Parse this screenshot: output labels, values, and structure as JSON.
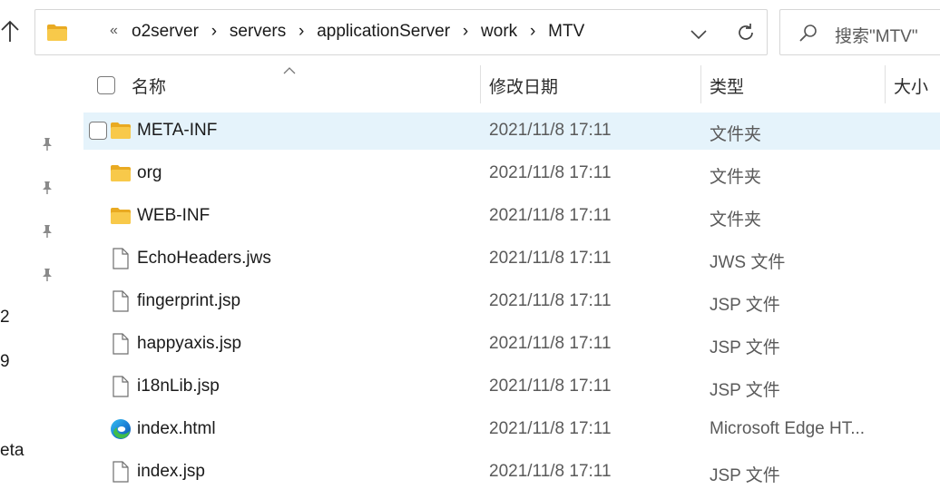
{
  "address_bar": {
    "overflow": "«",
    "crumbs": [
      "o2server",
      "servers",
      "applicationServer",
      "work",
      "MTV"
    ],
    "separator": "›"
  },
  "search": {
    "placeholder": "搜索\"MTV\""
  },
  "nav_fragments": [
    "2",
    "9",
    "eta"
  ],
  "columns": {
    "name": "名称",
    "date": "修改日期",
    "type": "类型",
    "size": "大小"
  },
  "files": [
    {
      "name": "META-INF",
      "date": "2021/11/8 17:11",
      "type": "文件夹",
      "icon": "folder-icon",
      "selected": true
    },
    {
      "name": "org",
      "date": "2021/11/8 17:11",
      "type": "文件夹",
      "icon": "folder-icon",
      "selected": false
    },
    {
      "name": "WEB-INF",
      "date": "2021/11/8 17:11",
      "type": "文件夹",
      "icon": "folder-icon",
      "selected": false
    },
    {
      "name": "EchoHeaders.jws",
      "date": "2021/11/8 17:11",
      "type": "JWS 文件",
      "icon": "file-icon",
      "selected": false
    },
    {
      "name": "fingerprint.jsp",
      "date": "2021/11/8 17:11",
      "type": "JSP 文件",
      "icon": "file-icon",
      "selected": false
    },
    {
      "name": "happyaxis.jsp",
      "date": "2021/11/8 17:11",
      "type": "JSP 文件",
      "icon": "file-icon",
      "selected": false
    },
    {
      "name": "i18nLib.jsp",
      "date": "2021/11/8 17:11",
      "type": "JSP 文件",
      "icon": "file-icon",
      "selected": false
    },
    {
      "name": "index.html",
      "date": "2021/11/8 17:11",
      "type": "Microsoft Edge HT...",
      "icon": "edge-icon",
      "selected": false
    },
    {
      "name": "index.jsp",
      "date": "2021/11/8 17:11",
      "type": "JSP 文件",
      "icon": "file-icon",
      "selected": false
    }
  ],
  "colors": {
    "selected_row": "#e5f3fb",
    "folder": "#f8c94a",
    "folder_dark": "#e9aa22"
  }
}
